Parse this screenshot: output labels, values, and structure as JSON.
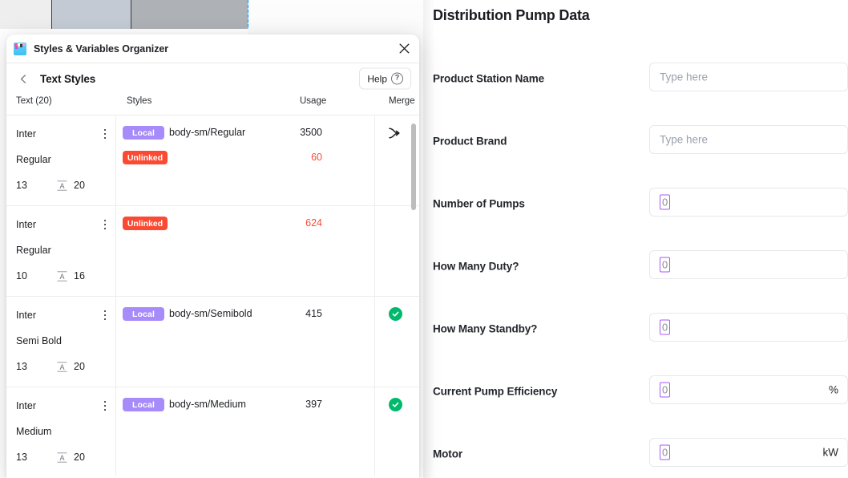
{
  "dialog": {
    "app_icon": "palette-icon",
    "title": "Styles & Variables Organizer",
    "close_icon": "close-icon",
    "back_icon": "chevron-left-icon",
    "section_title": "Text Styles",
    "help_label": "Help",
    "help_icon": "question-circle-icon",
    "columns": {
      "text": "Text (20)",
      "styles": "Styles",
      "usage": "Usage",
      "merge": "Merge"
    },
    "rows": [
      {
        "font_family": "Inter",
        "font_weight": "Regular",
        "font_size": "13",
        "line_height_icon": "line-height-icon",
        "line_height": "20",
        "kebab_icon": "more-vertical-icon",
        "chip_primary": "Local",
        "chip_primary_color": "#a78bfa",
        "style_name": "body-sm/Regular",
        "usage_main": "3500",
        "chip_secondary": "Unlinked",
        "chip_secondary_color": "#fc4a32",
        "usage_secondary": "60",
        "merge_icon": "merge-arrow-icon"
      },
      {
        "font_family": "Inter",
        "font_weight": "Regular",
        "font_size": "10",
        "line_height_icon": "line-height-icon",
        "line_height": "16",
        "kebab_icon": "more-vertical-icon",
        "chip_primary": "Unlinked",
        "chip_primary_color": "#fc4a32",
        "style_name": "",
        "usage_main": "624",
        "merge_icon": ""
      },
      {
        "font_family": "Inter",
        "font_weight": "Semi Bold",
        "font_size": "13",
        "line_height_icon": "line-height-icon",
        "line_height": "20",
        "kebab_icon": "more-vertical-icon",
        "chip_primary": "Local",
        "chip_primary_color": "#a78bfa",
        "style_name": "body-sm/Semibold",
        "usage_main": "415",
        "merge_icon": "check-circle-icon"
      },
      {
        "font_family": "Inter",
        "font_weight": "Medium",
        "font_size": "13",
        "line_height_icon": "line-height-icon",
        "line_height": "20",
        "kebab_icon": "more-vertical-icon",
        "chip_primary": "Local",
        "chip_primary_color": "#a78bfa",
        "style_name": "body-sm/Medium",
        "usage_main": "397",
        "merge_icon": "check-circle-icon"
      }
    ]
  },
  "form": {
    "title": "Distribution Pump Data",
    "fields": [
      {
        "label": "Product Station Name",
        "placeholder": "Type here",
        "value": "",
        "unit": "",
        "selected": false
      },
      {
        "label": "Product Brand",
        "placeholder": "Type here",
        "value": "",
        "unit": "",
        "selected": false
      },
      {
        "label": "Number of Pumps",
        "placeholder": "",
        "value": "0",
        "unit": "",
        "selected": true
      },
      {
        "label": "How Many Duty?",
        "placeholder": "",
        "value": "0",
        "unit": "",
        "selected": true
      },
      {
        "label": "How Many Standby?",
        "placeholder": "",
        "value": "0",
        "unit": "",
        "selected": true
      },
      {
        "label": "Current Pump Efficiency",
        "placeholder": "",
        "value": "0",
        "unit": "%",
        "selected": true
      },
      {
        "label": "Motor",
        "placeholder": "",
        "value": "0",
        "unit": "kW",
        "selected": true
      }
    ],
    "selection_color": "#a855f7"
  }
}
